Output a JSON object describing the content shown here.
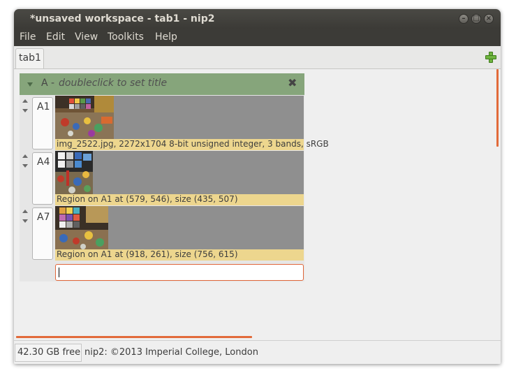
{
  "window": {
    "title": "*unsaved workspace - tab1 - nip2",
    "controls": [
      "minimize-icon",
      "maximize-icon",
      "close-icon"
    ]
  },
  "menubar": {
    "items": [
      "File",
      "Edit",
      "View",
      "Toolkits",
      "Help"
    ]
  },
  "tabs": {
    "active": "tab1",
    "add_icon": "plus-icon"
  },
  "column": {
    "name": "A -",
    "title_hint": "doubleclick to set title",
    "close_icon": "close-x-icon",
    "rows": [
      {
        "label": "A1",
        "caption": "img_2522.jpg, 2272x1704 8-bit unsigned integer, 3 bands, sRGB"
      },
      {
        "label": "A4",
        "caption": "Region on A1 at (579, 546), size (435, 507)"
      },
      {
        "label": "A7",
        "caption": "Region on A1 at (918, 261), size (756, 615)"
      }
    ],
    "entry_value": ""
  },
  "statusbar": {
    "free_space": "42.30 GB free",
    "copyright": "nip2: ©2013 Imperial College, London"
  },
  "colors": {
    "titlebar": "#3c3b37",
    "column_header": "#86a57b",
    "caption_bg": "#edd68e",
    "accent": "#e26a3a",
    "add_icon": "#6fb43f"
  }
}
